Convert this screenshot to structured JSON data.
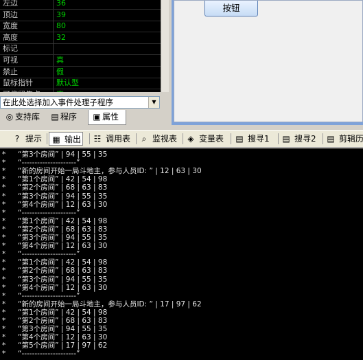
{
  "properties": [
    {
      "name": "左边",
      "value": "36"
    },
    {
      "name": "顶边",
      "value": "39"
    },
    {
      "name": "宽度",
      "value": "80"
    },
    {
      "name": "高度",
      "value": "32"
    },
    {
      "name": "标记",
      "value": ""
    },
    {
      "name": "可视",
      "value": "真"
    },
    {
      "name": "禁止",
      "value": "假"
    },
    {
      "name": "鼠标指针",
      "value": "默认型"
    },
    {
      "name": "可停留焦点",
      "value": "真"
    }
  ],
  "event_combo": {
    "text": "在此处选择加入事件处理子程序",
    "arrow": "▼"
  },
  "left_tabs": [
    {
      "icon": "support-library-icon",
      "glyph": "◎",
      "label": "支持库"
    },
    {
      "icon": "program-icon",
      "glyph": "▤",
      "label": "程序"
    },
    {
      "icon": "property-icon",
      "glyph": "▣",
      "label": "属性"
    }
  ],
  "designer": {
    "button_label": "按钮"
  },
  "bottom_tabs": [
    {
      "icon": "hint-icon",
      "glyph": "?",
      "label": "提示"
    },
    {
      "icon": "output-icon",
      "glyph": "▦",
      "label": "输出"
    },
    {
      "icon": "call-stack-icon",
      "glyph": "☷",
      "label": "调用表"
    },
    {
      "icon": "watch-icon",
      "glyph": "⌕",
      "label": "监视表"
    },
    {
      "icon": "variable-icon",
      "glyph": "◈",
      "label": "变量表"
    },
    {
      "icon": "search1-icon",
      "glyph": "▤",
      "label": "搜寻1"
    },
    {
      "icon": "search2-icon",
      "glyph": "▤",
      "label": "搜寻2"
    },
    {
      "icon": "clipboard-icon",
      "glyph": "▤",
      "label": "剪辑历"
    }
  ],
  "console_lines": [
    "“第3个房间” | 94 | 55 | 35",
    "“---------------------”",
    "“新的房间开始一局斗地主，参与人员ID: ” | 12 | 63 | 30",
    "“第1个房间” | 42 | 54 | 98",
    "“第2个房间” | 68 | 63 | 83",
    "“第3个房间” | 94 | 55 | 35",
    "“第4个房间” | 12 | 63 | 30",
    "“---------------------”",
    "“第1个房间” | 42 | 54 | 98",
    "“第2个房间” | 68 | 63 | 83",
    "“第3个房间” | 94 | 55 | 35",
    "“第4个房间” | 12 | 63 | 30",
    "“---------------------”",
    "“第1个房间” | 42 | 54 | 98",
    "“第2个房间” | 68 | 63 | 83",
    "“第3个房间” | 94 | 55 | 35",
    "“第4个房间” | 12 | 63 | 30",
    "“---------------------”",
    "“新的房间开始一局斗地主，参与人员ID: ” | 17 | 97 | 62",
    "“第1个房间” | 42 | 54 | 98",
    "“第2个房间” | 68 | 63 | 83",
    "“第3个房间” | 94 | 55 | 35",
    "“第4个房间” | 12 | 63 | 30",
    "“第5个房间” | 17 | 97 | 62",
    "“---------------------”"
  ]
}
